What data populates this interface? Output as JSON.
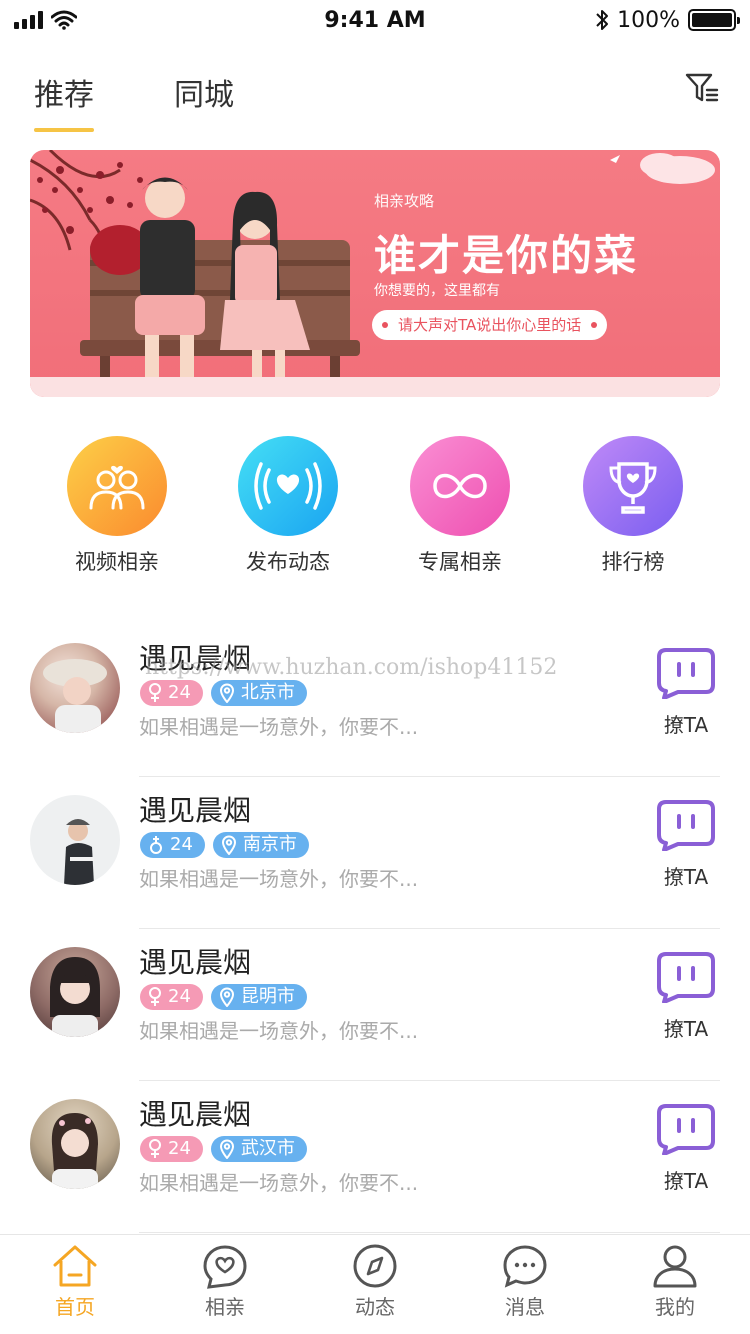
{
  "status_bar": {
    "time": "9:41 AM",
    "battery_label": "100%",
    "battery_level": 1.0
  },
  "header": {
    "tabs": [
      {
        "label": "推荐",
        "active": true
      },
      {
        "label": "同城",
        "active": false
      }
    ],
    "filter_icon": "filter-icon"
  },
  "banner": {
    "subtitle": "相亲攻略",
    "title": "谁才是你的菜",
    "description": "你想要的，这里都有",
    "button": "请大声对TA说出你心里的话"
  },
  "quick_actions": [
    {
      "label": "视频相亲",
      "icon": "couple-icon",
      "color": "#fbac2e"
    },
    {
      "label": "发布动态",
      "icon": "heart-broadcast-icon",
      "color": "#2bc4f4"
    },
    {
      "label": "专属相亲",
      "icon": "linked-hearts-icon",
      "color": "#f46ec2"
    },
    {
      "label": "排行榜",
      "icon": "trophy-icon",
      "color": "#9b6cf0"
    }
  ],
  "matches": [
    {
      "name": "遇见晨烟",
      "gender": "female",
      "age": "24",
      "city": "北京市",
      "message": "如果相遇是一场意外，你要不...",
      "action": "撩TA"
    },
    {
      "name": "遇见晨烟",
      "gender": "male",
      "age": "24",
      "city": "南京市",
      "message": "如果相遇是一场意外，你要不...",
      "action": "撩TA"
    },
    {
      "name": "遇见晨烟",
      "gender": "female",
      "age": "24",
      "city": "昆明市",
      "message": "如果相遇是一场意外，你要不...",
      "action": "撩TA"
    },
    {
      "name": "遇见晨烟",
      "gender": "female",
      "age": "24",
      "city": "武汉市",
      "message": "如果相遇是一场意外，你要不...",
      "action": "撩TA"
    }
  ],
  "watermark": "https://www.huzhan.com/ishop41152",
  "bottom_nav": [
    {
      "label": "首页",
      "icon": "home-icon",
      "active": true
    },
    {
      "label": "相亲",
      "icon": "heart-chat-icon",
      "active": false
    },
    {
      "label": "动态",
      "icon": "compass-icon",
      "active": false
    },
    {
      "label": "消息",
      "icon": "message-icon",
      "active": false
    },
    {
      "label": "我的",
      "icon": "user-icon",
      "active": false
    }
  ],
  "colors": {
    "accent": "#f6c445",
    "nav_active": "#f5a623",
    "tag_female": "#f59ab5",
    "tag_blue": "#67b1ef",
    "chat_purple": "#8a5fd6"
  }
}
